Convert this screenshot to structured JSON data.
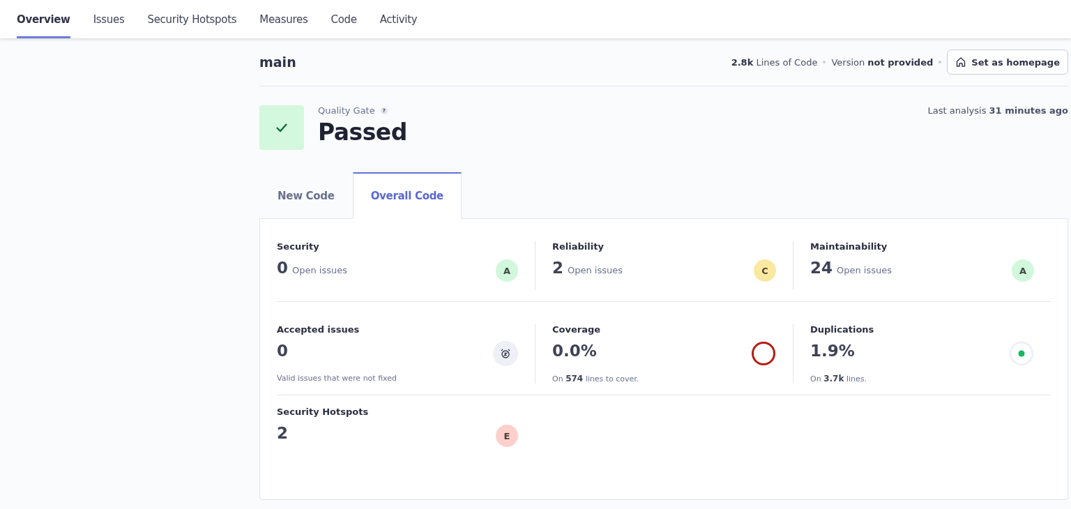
{
  "nav": {
    "tabs": [
      {
        "label": "Overview",
        "selected": true
      },
      {
        "label": "Issues",
        "selected": false
      },
      {
        "label": "Security Hotspots",
        "selected": false
      },
      {
        "label": "Measures",
        "selected": false
      },
      {
        "label": "Code",
        "selected": false
      },
      {
        "label": "Activity",
        "selected": false
      }
    ]
  },
  "branch": {
    "name": "main",
    "meta": [
      "**2.8k** Lines of Code",
      "Version **not provided**"
    ],
    "homepage_button": "Set as homepage"
  },
  "quality_gate": {
    "label": "Quality Gate",
    "help": "?",
    "status": "Passed",
    "passed": true,
    "last_analysis": "Last analysis **31 minutes ago**"
  },
  "code_tabs": [
    {
      "label": "New Code",
      "selected": false
    },
    {
      "label": "Overall Code",
      "selected": true
    }
  ],
  "metric_rows": [
    [
      {
        "kind": "issues",
        "title": "Security",
        "value": "0",
        "unit": "Open issues",
        "rating": "A",
        "color": "#d1f7dc"
      },
      {
        "kind": "issues",
        "title": "Reliability",
        "value": "2",
        "unit": "Open issues",
        "rating": "C",
        "color": "#fbe8a0"
      },
      {
        "kind": "issues",
        "title": "Maintainability",
        "value": "24",
        "unit": "Open issues",
        "rating": "A",
        "color": "#d1f7dc"
      }
    ],
    [
      {
        "kind": "accepted",
        "title": "Accepted issues",
        "value": "0",
        "note": "Valid issues that were not fixed"
      },
      {
        "kind": "coverage",
        "title": "Coverage",
        "value": "0.0%",
        "note": "On **574** lines to cover."
      },
      {
        "kind": "duplication",
        "title": "Duplications",
        "value": "1.9%",
        "note": "On **3.7k** lines."
      }
    ],
    [
      {
        "kind": "hotspots",
        "title": "Security Hotspots",
        "value": "2",
        "rating": "E",
        "color": "#fdd0cb"
      }
    ]
  ]
}
